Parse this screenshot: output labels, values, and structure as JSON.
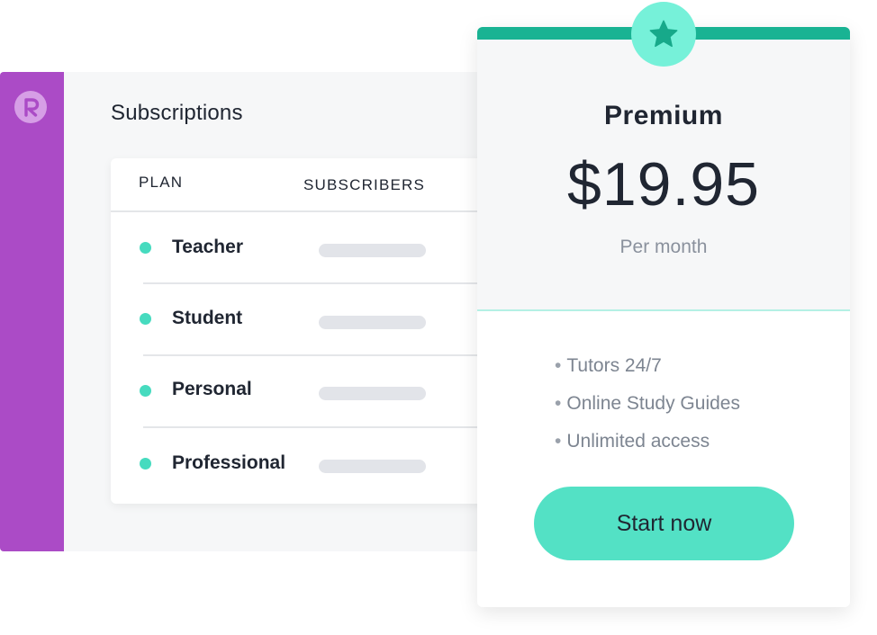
{
  "app": {
    "logo_icon": "r-logo-icon",
    "sidebar_color": "#ab4bc6"
  },
  "subscriptions": {
    "title": "Subscriptions",
    "columns": [
      "PLAN",
      "SUBSCRIBERS"
    ],
    "rows": [
      {
        "plan": "Teacher"
      },
      {
        "plan": "Student"
      },
      {
        "plan": "Personal"
      },
      {
        "plan": "Professional"
      }
    ]
  },
  "pricing": {
    "badge_icon": "star-icon",
    "plan": "Premium",
    "price": "$19.95",
    "period": "Per month",
    "features": [
      "Tutors 24/7",
      "Online Study Guides",
      "Unlimited access"
    ],
    "cta_label": "Start now",
    "accent_color": "#19b393",
    "cta_color": "#53e1c5"
  }
}
